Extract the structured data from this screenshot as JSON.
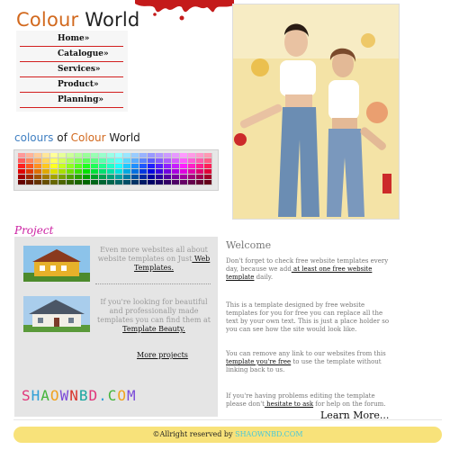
{
  "header": {
    "logo_part1": "Colour",
    "logo_part2": "World"
  },
  "nav": {
    "items": [
      {
        "label": "Home»"
      },
      {
        "label": "Catalogue»"
      },
      {
        "label": "Services»"
      },
      {
        "label": "Product»"
      },
      {
        "label": "Planning»"
      }
    ]
  },
  "colours": {
    "title_a": "colours",
    "title_b": "of",
    "title_c": "Colour",
    "title_d": "World"
  },
  "project": {
    "title": "Project",
    "item1_text_before": "Even more websites all about website templates on Just",
    "item1_link": " Web Templates.",
    "item2_text_before": "If you're looking for beautiful and professionally made templates you can find them at",
    "item2_link": " Template Beauty.",
    "more_projects": "More projects",
    "shaow_logo": "SHAOWNBD.COM"
  },
  "welcome": {
    "title": "Welcome",
    "para1_a": "Don't forget to check free website templates every day, because we add",
    "para1_link": " at least one free website template",
    "para1_b": " daily.",
    "para2": "This is a template designed by free website templates for you for free you can replace all the text by your own text. This is just a place holder so you can see how the site would look like.",
    "para3_a": "You can remove any link to our websites from this",
    "para3_link": " template you're free",
    "para3_b": " to use the template without linking back to us.",
    "para4_a": "If you're having problems editing the template please don't",
    "para4_link": " hesitate to ask",
    "para4_b": " for help on the forum.",
    "learn_more": "Learn More..."
  },
  "footer": {
    "text": "©Allright reserved by",
    "brand": " SHAOWNBD.COM"
  },
  "colors": {
    "accent_orange": "#d2691e",
    "project_pink": "#cc1fa2",
    "nav_red": "#d21e1e",
    "footer_yellow": "#f8e27a"
  }
}
